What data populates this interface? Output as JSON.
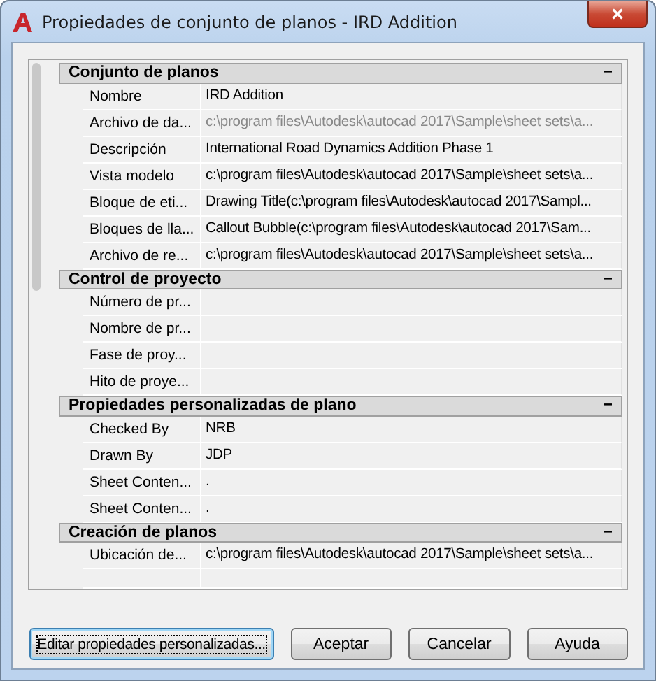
{
  "window": {
    "title": "Propiedades de conjunto de planos - IRD Addition",
    "close": "×"
  },
  "sections": [
    {
      "title": "Conjunto de planos",
      "toggle": "−",
      "rows": [
        {
          "label": "Nombre",
          "value": "IRD Addition",
          "disabled": false
        },
        {
          "label": "Archivo de da...",
          "value": "c:\\program files\\Autodesk\\autocad 2017\\Sample\\sheet sets\\a...",
          "disabled": true
        },
        {
          "label": "Descripción",
          "value": "International Road Dynamics Addition Phase 1",
          "disabled": false
        },
        {
          "label": "Vista modelo",
          "value": "c:\\program files\\Autodesk\\autocad 2017\\Sample\\sheet sets\\a...",
          "disabled": false
        },
        {
          "label": "Bloque de eti...",
          "value": "Drawing Title(c:\\program files\\Autodesk\\autocad 2017\\Sampl...",
          "disabled": false
        },
        {
          "label": "Bloques de lla...",
          "value": "Callout Bubble(c:\\program files\\Autodesk\\autocad 2017\\Sam...",
          "disabled": false
        },
        {
          "label": "Archivo de re...",
          "value": "c:\\program files\\Autodesk\\autocad 2017\\Sample\\sheet sets\\a...",
          "disabled": false
        }
      ]
    },
    {
      "title": "Control de proyecto",
      "toggle": "−",
      "rows": [
        {
          "label": "Número de pr..."
        },
        {
          "label": "Nombre de pr..."
        },
        {
          "label": "Fase de proy..."
        },
        {
          "label": "Hito de proye..."
        }
      ]
    },
    {
      "title": "Propiedades personalizadas de plano",
      "toggle": "−",
      "rows": [
        {
          "label": "Checked By",
          "value": "NRB",
          "disabled": false
        },
        {
          "label": "Drawn By",
          "value": "JDP",
          "disabled": false
        },
        {
          "label": "Sheet Conten...",
          "value": ".",
          "disabled": false
        },
        {
          "label": "Sheet Conten...",
          "value": ".",
          "disabled": false
        }
      ]
    },
    {
      "title": "Creación de planos",
      "toggle": "−",
      "rows": [
        {
          "label": "Ubicación de...",
          "value": "c:\\program files\\Autodesk\\autocad 2017\\Sample\\sheet sets\\a...",
          "disabled": false
        },
        {}
      ]
    }
  ],
  "buttons": [
    {
      "label": "Editar propiedades personalizadas...",
      "focused": true
    },
    {
      "label": "Aceptar",
      "focused": false
    },
    {
      "label": "Cancelar",
      "focused": false
    },
    {
      "label": "Ayuda",
      "focused": false
    }
  ]
}
